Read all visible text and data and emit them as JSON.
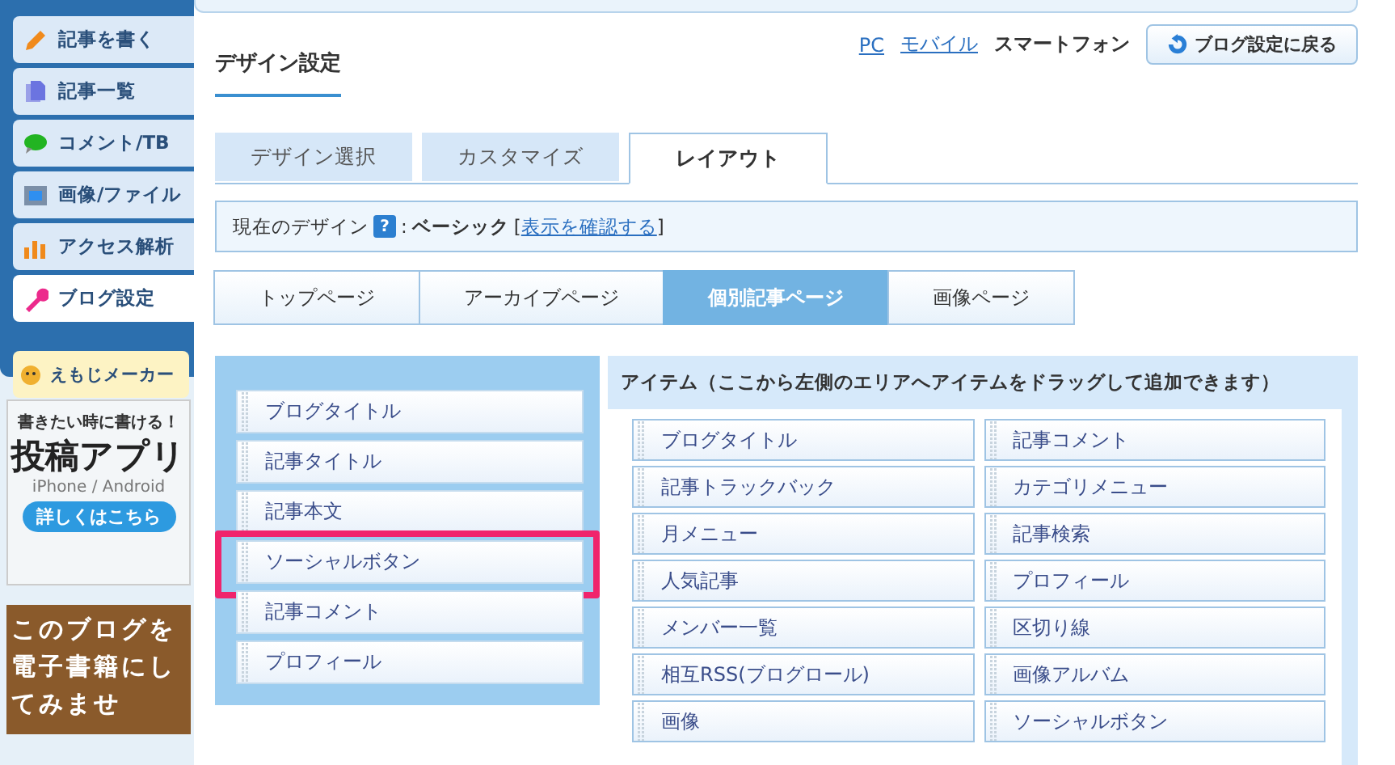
{
  "sidebar": {
    "items": [
      {
        "label": "記事を書く",
        "selected": false
      },
      {
        "label": "記事一覧",
        "selected": false
      },
      {
        "label": "コメント/TB",
        "selected": false
      },
      {
        "label": "画像/ファイル",
        "selected": false
      },
      {
        "label": "アクセス解析",
        "selected": false
      },
      {
        "label": "ブログ設定",
        "selected": true
      }
    ],
    "emoji_button": "えもじメーカー",
    "app_banner": {
      "tagline": "書きたい時に書ける！",
      "title": "投稿アプリ",
      "platforms": "iPhone / Android",
      "button": "詳しくはこちら"
    },
    "ebook_banner": "このブログを電子書籍にしてみませ"
  },
  "header": {
    "title": "デザイン設定",
    "device_links": [
      {
        "label": "PC",
        "selected": false
      },
      {
        "label": "モバイル",
        "selected": false
      },
      {
        "label": "スマートフォン",
        "selected": true
      }
    ],
    "back_button": "ブログ設定に戻る"
  },
  "tabs": [
    {
      "label": "デザイン選択",
      "selected": false
    },
    {
      "label": "カスタマイズ",
      "selected": false
    },
    {
      "label": "レイアウト",
      "selected": true
    }
  ],
  "current_design": {
    "label": "現在のデザイン",
    "help": "?",
    "separator": ":",
    "name": "ベーシック",
    "bracket_open": "[",
    "link": "表示を確認する",
    "bracket_close": "]"
  },
  "page_tabs": [
    {
      "label": "トップページ",
      "selected": false
    },
    {
      "label": "アーカイブページ",
      "selected": false
    },
    {
      "label": "個別記事ページ",
      "selected": true
    },
    {
      "label": "画像ページ",
      "selected": false
    }
  ],
  "layout_area": {
    "items": [
      {
        "label": "ブログタイトル",
        "highlighted": false
      },
      {
        "label": "記事タイトル",
        "highlighted": false
      },
      {
        "label": "記事本文",
        "highlighted": false
      },
      {
        "label": "ソーシャルボタン",
        "highlighted": true
      },
      {
        "label": "記事コメント",
        "highlighted": false
      },
      {
        "label": "プロフィール",
        "highlighted": false
      }
    ]
  },
  "item_panel": {
    "title": "アイテム（ここから左側のエリアへアイテムをドラッグして追加できます）",
    "items": [
      "ブログタイトル",
      "記事コメント",
      "記事トラックバック",
      "カテゴリメニュー",
      "月メニュー",
      "記事検索",
      "人気記事",
      "プロフィール",
      "メンバー一覧",
      "区切り線",
      "相互RSS(ブログロール)",
      "画像アルバム",
      "画像",
      "ソーシャルボタン"
    ]
  }
}
